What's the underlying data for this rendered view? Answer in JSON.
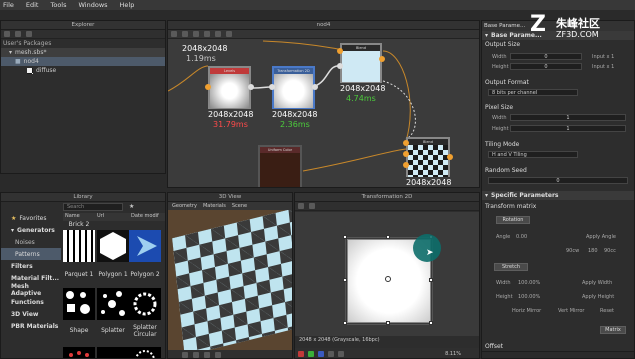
{
  "menu": [
    "File",
    "Edit",
    "Tools",
    "Windows",
    "Help"
  ],
  "watermark": {
    "cn": "朱峰社区",
    "url": "ZF3D.COM"
  },
  "explorer": {
    "title": "Explorer",
    "packages_label": "User's Packages",
    "items": [
      "mesh.sbs*",
      "nod4",
      "diffuse"
    ]
  },
  "graph": {
    "title": "nod4",
    "nodes": [
      {
        "head": "Levels",
        "res": "2048x2048",
        "ms": "31.79ms",
        "ms_color": "#ff4a4a"
      },
      {
        "head": "Transformation 2D",
        "res": "2048x2048",
        "ms": "2.36ms",
        "ms_color": "#4ccb3c"
      },
      {
        "head": "Blend",
        "res": "2048x2048",
        "ms": "4.74ms",
        "ms_color": "#4ccb3c"
      },
      {
        "head": "Uniform Color",
        "res": "",
        "ms": "",
        "ms_color": "#4ccb3c"
      },
      {
        "head": "Blend",
        "res": "2048x2048",
        "ms": "",
        "ms_color": "#4ccb3c"
      },
      {
        "head": "",
        "res": "2048x2048",
        "ms": "1.19ms",
        "ms_color": "#4ccb3c"
      }
    ]
  },
  "library": {
    "title": "Library",
    "search_placeholder": "Search",
    "columns": [
      "Name",
      "Url",
      "Date modif"
    ],
    "categories": [
      "Favorites",
      "Generators",
      "Noises",
      "Patterns",
      "Filters",
      "Material Filt...",
      "Mesh Adaptive",
      "Functions",
      "3D View",
      "PBR Materials"
    ],
    "items": [
      "Brick 2",
      "Parquet 1",
      "Polygon 1",
      "Polygon 2",
      "Shape",
      "Splatter",
      "Splatter Circular"
    ]
  },
  "view3d": {
    "title": "3D View",
    "menu": [
      "Geometry",
      "Materials",
      "Scene"
    ]
  },
  "view2d": {
    "title": "Transformation 2D",
    "status": "2048 x 2048 (Grayscale, 16bpc)",
    "zoom": "8.11%"
  },
  "params": {
    "tab": "Base Parame...",
    "output_size": {
      "label": "Output Size",
      "width_label": "Width",
      "width": "0",
      "width_mode": "Input x 1",
      "height_label": "Height",
      "height": "0",
      "height_mode": "Input x 1"
    },
    "output_format": {
      "label": "Output Format",
      "value": "8 bits per channel"
    },
    "pixel_size": {
      "label": "Pixel Size",
      "width_label": "Width",
      "width": "1",
      "height_label": "Height",
      "height": "1"
    },
    "tiling": {
      "label": "Tiling Mode",
      "value": "H and V Tiling"
    },
    "random_seed": {
      "label": "Random Seed",
      "value": "0"
    },
    "specific": {
      "label": "Specific Parameters",
      "matrix_label": "Transform matrix",
      "rotation_btn": "Rotation",
      "angle_label": "Angle",
      "angle": "0.00",
      "apply_angle": "Apply Angle",
      "rot_values": [
        "90cw",
        "180",
        "90cc"
      ],
      "stretch_btn": "Stretch",
      "width_label": "Width",
      "width": "100.00%",
      "apply_width": "Apply Width",
      "height_label": "Height",
      "height": "100.00%",
      "apply_height": "Apply Height",
      "mirror_h": "Horiz Mirror",
      "mirror_v": "Vert Mirror",
      "reset": "Reset",
      "matrix_btn": "Matrix",
      "offset_label": "Offset"
    }
  }
}
